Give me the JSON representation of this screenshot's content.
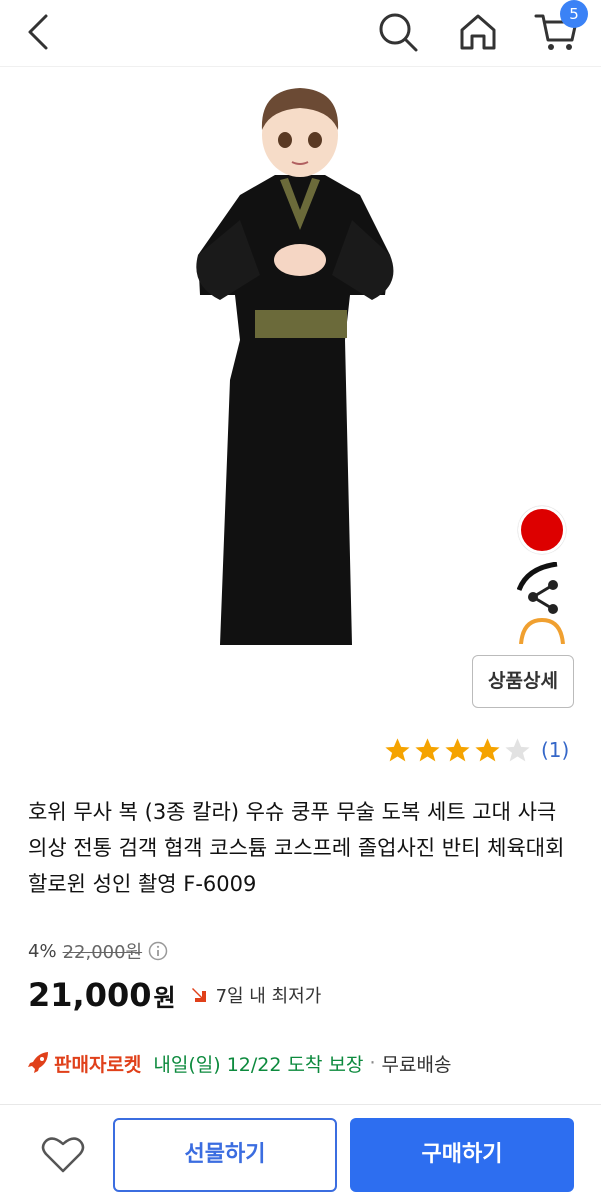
{
  "header": {
    "back_icon": "chevron-left-icon",
    "search_icon": "search-icon",
    "home_icon": "home-icon",
    "cart_icon": "cart-icon",
    "cart_count": "5"
  },
  "product": {
    "image_alt": "black martial arts robe costume",
    "color_options": [
      "red",
      "black",
      "orange"
    ],
    "detail_button": "상품상세",
    "rating": {
      "stars": 4,
      "max": 5,
      "count": "(1)"
    },
    "title": "호위 무사 복 (3종 칼라) 우슈 쿵푸 무술 도복 세트 고대 사극 의상 전통 검객 협객 코스튬 코스프레 졸업사진 반티 체육대회 할로윈 성인 촬영 F-6009",
    "discount_percent": "4%",
    "original_price": "22,000원",
    "price": "21,000",
    "price_unit": "원",
    "lowest_label": "7일 내 최저가",
    "delivery": {
      "badge": "판매자로켓",
      "date": "내일(일) 12/22 도착 보장",
      "separator": "·",
      "shipping": "무료배송"
    }
  },
  "actions": {
    "wishlist_icon": "heart-icon",
    "gift_label": "선물하기",
    "buy_label": "구매하기"
  },
  "colors": {
    "accent": "#2d6ef0",
    "rocket": "#e0401a",
    "delivery": "#0d8a3e",
    "star": "#f5a300"
  }
}
